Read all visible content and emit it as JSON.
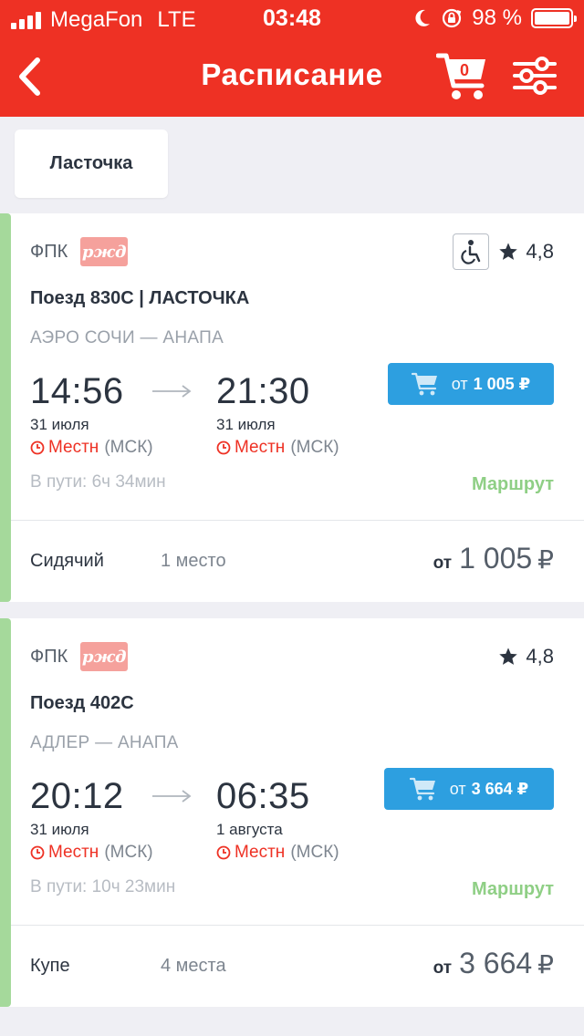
{
  "status_bar": {
    "carrier": "MegaFon",
    "network": "LTE",
    "time": "03:48",
    "battery": "98 %"
  },
  "header": {
    "title": "Расписание",
    "cart_count": "0"
  },
  "filter_chip": {
    "label": "Ласточка"
  },
  "trains": [
    {
      "carrier": "ФПК",
      "logo_text": "ржд",
      "rating": "4,8",
      "title": "Поезд 830С | ЛАСТОЧКА",
      "route": "АЭРО СОЧИ — АНАПА",
      "dep_time": "14:56",
      "dep_date": "31 июля",
      "arr_time": "21:30",
      "arr_date": "31 июля",
      "tz_local": "Местн",
      "tz_msk": "(МСК)",
      "buy_from": "от",
      "buy_price": "1 005 ₽",
      "duration": "В пути: 6ч 34мин",
      "route_link": "Маршрут",
      "seat_type": "Сидячий",
      "seat_count": "1 место",
      "seat_from": "от",
      "seat_price": "1 005",
      "currency": "₽"
    },
    {
      "carrier": "ФПК",
      "logo_text": "ржд",
      "rating": "4,8",
      "title": "Поезд 402С",
      "route": "АДЛЕР — АНАПА",
      "dep_time": "20:12",
      "dep_date": "31 июля",
      "arr_time": "06:35",
      "arr_date": "1 августа",
      "tz_local": "Местн",
      "tz_msk": "(МСК)",
      "buy_from": "от",
      "buy_price": "3 664 ₽",
      "duration": "В пути: 10ч 23мин",
      "route_link": "Маршрут",
      "seat_type": "Купе",
      "seat_count": "4 места",
      "seat_from": "от",
      "seat_price": "3 664",
      "currency": "₽"
    }
  ],
  "colors": {
    "header_red": "#ee3124",
    "buy_blue": "#2d9fe0",
    "accent_green": "#a5d99b",
    "route_green": "#8fcf85",
    "local_time_red": "#ee3124"
  },
  "icons": [
    "signal-icon",
    "moon-icon",
    "rotation-lock-icon",
    "battery-icon",
    "back-chevron-icon",
    "cart-icon",
    "filter-sliders-icon",
    "wheelchair-icon",
    "star-icon",
    "clock-icon",
    "arrow-right-icon"
  ]
}
